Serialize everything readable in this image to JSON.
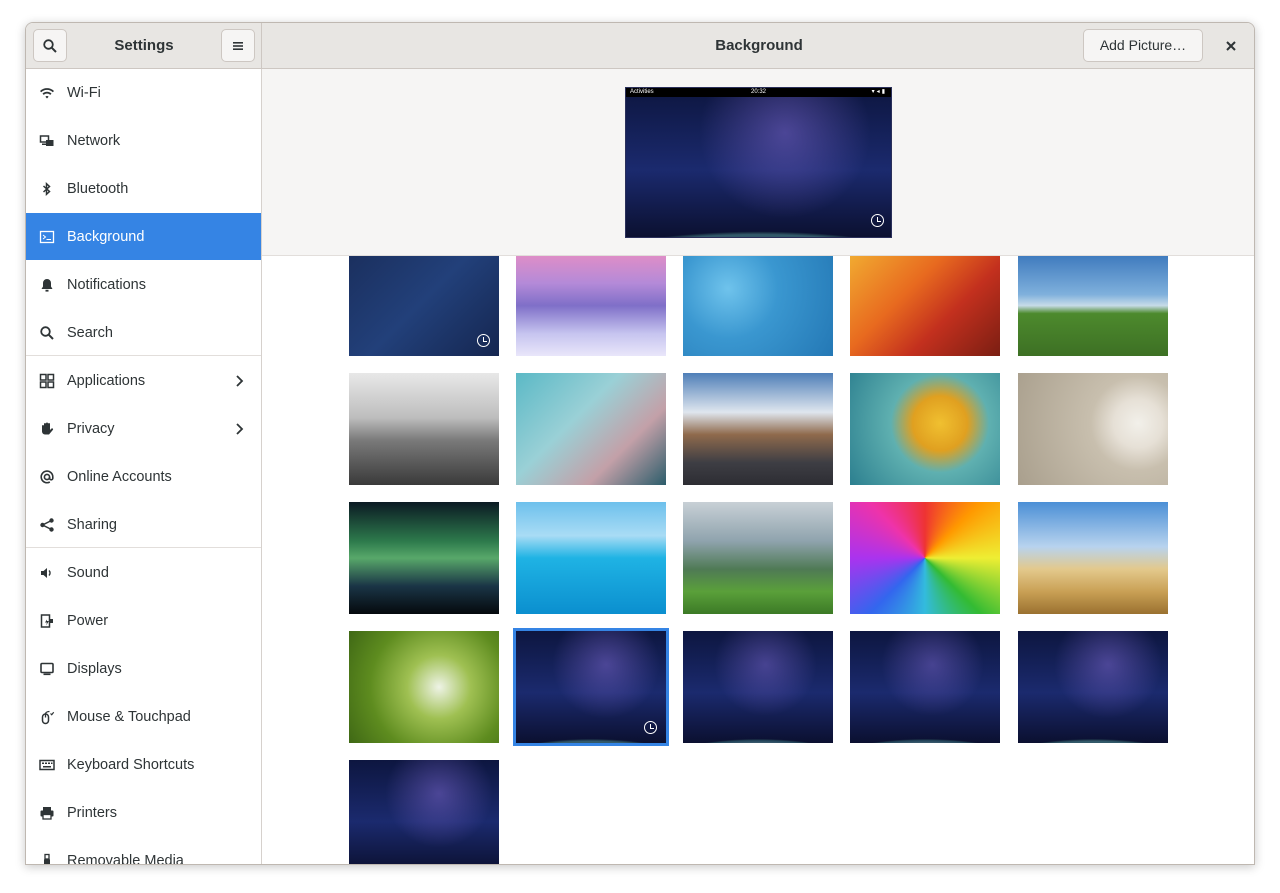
{
  "header": {
    "sidebar_title": "Settings",
    "main_title": "Background",
    "add_picture_label": "Add Picture…"
  },
  "sidebar": {
    "items": [
      {
        "label": "Wi-Fi",
        "icon": "wifi-icon"
      },
      {
        "label": "Network",
        "icon": "network-icon"
      },
      {
        "label": "Bluetooth",
        "icon": "bluetooth-icon"
      },
      {
        "label": "Background",
        "icon": "background-icon",
        "active": true
      },
      {
        "label": "Notifications",
        "icon": "bell-icon"
      },
      {
        "label": "Search",
        "icon": "search-icon"
      },
      {
        "label": "Applications",
        "icon": "applications-icon",
        "chevron": true
      },
      {
        "label": "Privacy",
        "icon": "hand-icon",
        "chevron": true
      },
      {
        "label": "Online Accounts",
        "icon": "at-icon"
      },
      {
        "label": "Sharing",
        "icon": "share-icon"
      },
      {
        "label": "Sound",
        "icon": "speaker-icon"
      },
      {
        "label": "Power",
        "icon": "power-icon"
      },
      {
        "label": "Displays",
        "icon": "display-icon"
      },
      {
        "label": "Mouse & Touchpad",
        "icon": "mouse-icon"
      },
      {
        "label": "Keyboard Shortcuts",
        "icon": "keyboard-icon"
      },
      {
        "label": "Printers",
        "icon": "printer-icon"
      },
      {
        "label": "Removable Media",
        "icon": "usb-icon"
      }
    ]
  },
  "preview": {
    "topbar_left": "Activities",
    "topbar_time": "20:32",
    "has_timed_badge": true
  },
  "wallpapers": [
    {
      "name": "blue-geometric",
      "style": "t-blue",
      "timed": true
    },
    {
      "name": "winter-forest",
      "style": "t-winter"
    },
    {
      "name": "blue-knit",
      "style": "t-blue-knit"
    },
    {
      "name": "woven-fabric",
      "style": "t-fabric"
    },
    {
      "name": "green-field",
      "style": "t-field"
    },
    {
      "name": "foggy-pier",
      "style": "t-pier"
    },
    {
      "name": "cherry-blossom",
      "style": "t-blossom"
    },
    {
      "name": "desert-road",
      "style": "t-road"
    },
    {
      "name": "yellow-frog",
      "style": "t-frog"
    },
    {
      "name": "zen-stones",
      "style": "t-zen"
    },
    {
      "name": "aurora",
      "style": "t-aurora"
    },
    {
      "name": "tropical-sea",
      "style": "t-sea"
    },
    {
      "name": "mountain-valley",
      "style": "t-valley"
    },
    {
      "name": "colored-pencils",
      "style": "t-pencils"
    },
    {
      "name": "wheat-field",
      "style": "t-wheat"
    },
    {
      "name": "dandelions",
      "style": "t-dandelion"
    },
    {
      "name": "earth-night-timed",
      "style": "earth",
      "timed": true,
      "selected": true
    },
    {
      "name": "earth-day",
      "style": "earth-white"
    },
    {
      "name": "earth-day-2",
      "style": "earth-white"
    },
    {
      "name": "earth-night",
      "style": "earth"
    },
    {
      "name": "earth-night-2",
      "style": "earth"
    }
  ]
}
